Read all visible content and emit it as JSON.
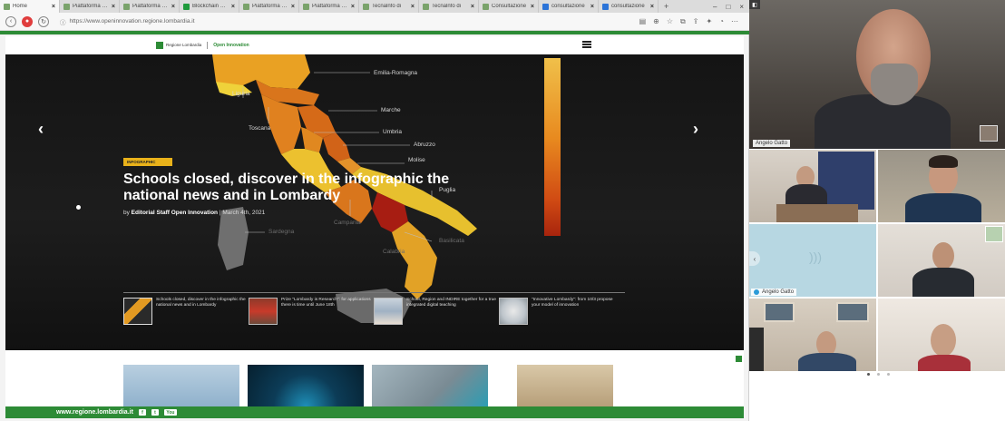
{
  "browser": {
    "tabs": [
      {
        "label": "Home",
        "active": true,
        "icon": "green"
      },
      {
        "label": "Piattaforma Gu",
        "active": false,
        "icon": "green"
      },
      {
        "label": "Piattaforma Gu",
        "active": false,
        "icon": "green"
      },
      {
        "label": "Blockchain nelle",
        "active": false,
        "icon": "green2"
      },
      {
        "label": "Piattaforma Gu",
        "active": false,
        "icon": "green"
      },
      {
        "label": "Piattaforma Gu",
        "active": false,
        "icon": "green"
      },
      {
        "label": "Tecnalnfo di",
        "active": false,
        "icon": "green"
      },
      {
        "label": "Tecnalnfo di",
        "active": false,
        "icon": "green"
      },
      {
        "label": "Consultazione",
        "active": false,
        "icon": "green"
      },
      {
        "label": "consultazione",
        "active": false,
        "icon": "blue"
      },
      {
        "label": "consultazione",
        "active": false,
        "icon": "blue"
      }
    ],
    "url": "https://www.openinnovation.regione.lombardia.it"
  },
  "site": {
    "logo_text": "Regione Lombardia",
    "logo_section": "Open Innovation",
    "hero": {
      "badge": "INFOGRAPHIC",
      "headline": "Schools closed, discover in the infographic the national news and in Lombardy",
      "byline_prefix": "by ",
      "byline_author": "Editorial Staff Open Innovation",
      "byline_date": " | March 4th, 2021",
      "regions": {
        "emilia_romagna": "Emilia-Romagna",
        "liguria": "Liguria",
        "toscana": "Toscana",
        "marche": "Marche",
        "umbria": "Umbria",
        "abruzzo": "Abruzzo",
        "molise": "Molise",
        "puglia": "Puglia",
        "campania": "Campania",
        "sardegna": "Sardegna",
        "basilicata": "Basilicata",
        "calabria": "Calabria"
      },
      "thumbs": [
        "Schools closed, discover in the infographic the national news and in Lombardy",
        "Prize \"Lombardy is Research\": for applications there is time until June 18th",
        "School, Region and INDIRE together for a true integrated digital teaching",
        "\"Innovative Lombardy\": from 10/3 propose your model of innovation"
      ]
    },
    "footer_url": "www.regione.lombardia.it",
    "footer_social": {
      "facebook": "f",
      "twitter": "t",
      "youtube": "You"
    }
  },
  "call": {
    "speaker_name": "Angelo Gatto",
    "gallery_name": "Angelo Gatto"
  },
  "colors": {
    "brand_green": "#2d8b36",
    "badge_yellow": "#e9b21a"
  }
}
